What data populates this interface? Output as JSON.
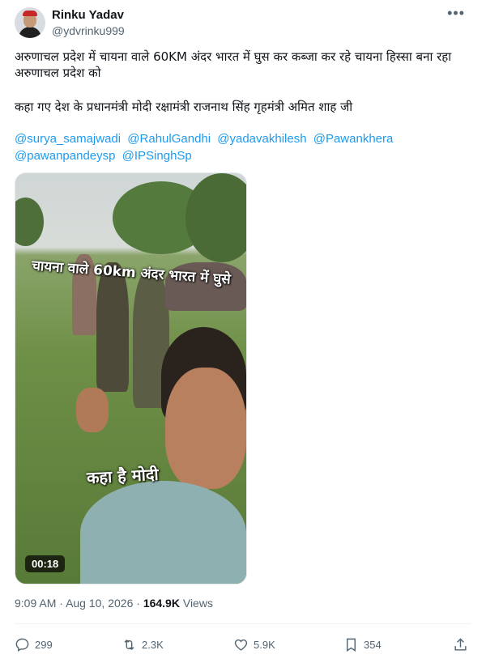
{
  "author": {
    "name": "Rinku Yadav",
    "handle": "@ydvrinku999"
  },
  "post": {
    "line1": "अरुणाचल प्रदेश में चायना वाले 60KM अंदर भारत में घुस कर कब्जा कर रहे चायना हिस्सा बना रहा अरुणाचल प्रदेश को",
    "line2": "कहा गए देश के प्रधानमंत्री मोदी रक्षामंत्री राजनाथ सिंह गृहमंत्री अमित शाह जी",
    "mentions": [
      "@surya_samajwadi",
      "@RahulGandhi",
      "@yadavakhilesh",
      "@Pawankhera",
      "@pawanpandeysp",
      "@IPSinghSp"
    ]
  },
  "media": {
    "caption_top": "चायना वाले 60km अंदर भारत में घुसे",
    "caption_bottom": "कहा है मोदी",
    "duration": "00:18"
  },
  "meta": {
    "time": "9:09 AM",
    "separator": "·",
    "date": "Aug 10, 2026",
    "dot": "·",
    "views_count": "164.9K",
    "views_label": "Views"
  },
  "actions": {
    "replies": "299",
    "reposts": "2.3K",
    "likes": "5.9K",
    "bookmarks": "354"
  },
  "icons": [
    "more-icon",
    "reply-icon",
    "repost-icon",
    "like-icon",
    "bookmark-icon",
    "share-icon"
  ],
  "colors": {
    "link": "#1d9bf0",
    "muted": "#536471"
  }
}
